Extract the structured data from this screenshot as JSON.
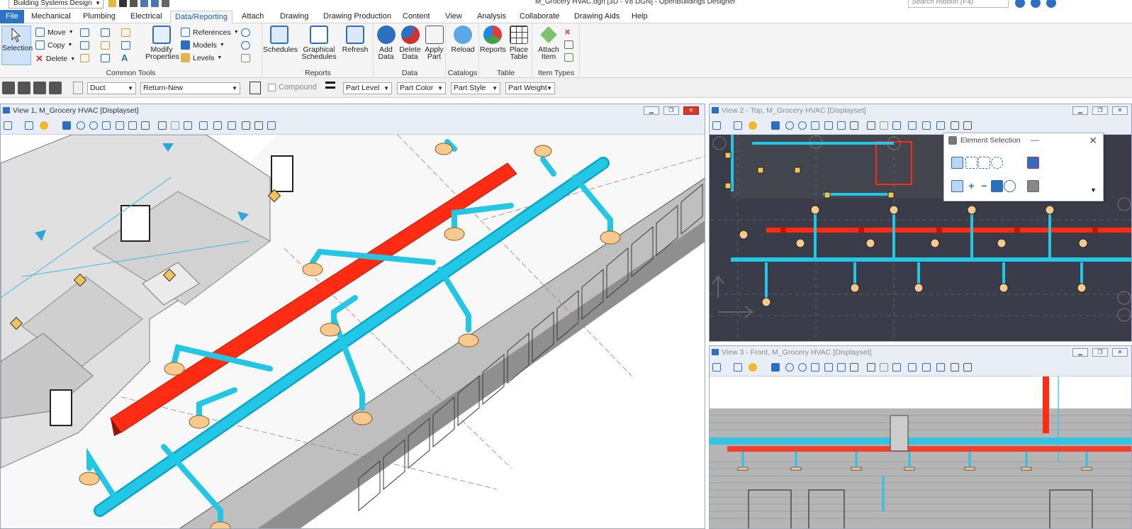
{
  "titlebar": {
    "workspace": "Building Systems Design",
    "title": "M_Grocery HVAC.dgn [3D - V8 DGN] - OpenBuildings Designer",
    "search_placeholder": "Search Ribbon (F4)"
  },
  "menu": {
    "tabs": [
      "File",
      "Mechanical",
      "Plumbing",
      "Electrical",
      "Data/Reporting",
      "Attach",
      "Drawing",
      "Drawing Production",
      "Content",
      "View",
      "Analysis",
      "Collaborate",
      "Drawing Aids",
      "Help"
    ],
    "active": "Data/Reporting"
  },
  "ribbon": {
    "common_tools": {
      "label": "Common Tools",
      "selection": "Selection",
      "move": "Move",
      "copy": "Copy",
      "delete": "Delete",
      "modify_properties": "Modify Properties",
      "references": "References",
      "models": "Models",
      "levels": "Levels"
    },
    "reports": {
      "label": "Reports",
      "schedules": "Schedules",
      "graphical_schedules": "Graphical Schedules",
      "refresh": "Refresh"
    },
    "data": {
      "label": "Data",
      "add_data": "Add Data",
      "delete_data": "Delete Data",
      "apply_part": "Apply Part"
    },
    "catalogs": {
      "label": "Catalogs",
      "reload": "Reload"
    },
    "table": {
      "label": "Table",
      "reports": "Reports",
      "place_table": "Place Table"
    },
    "item_types": {
      "label": "Item Types",
      "attach_item": "Attach Item"
    }
  },
  "toolrow": {
    "type": "Duct",
    "part": "Return-New",
    "compound": "Compound",
    "part_level": "Part Level",
    "part_color": "Part Color",
    "part_style": "Part Style",
    "part_weight": "Part Weight"
  },
  "views": {
    "v1": "View 1, M_Grocery HVAC [Displayset]",
    "v2": "View 2 - Top, M_Grocery HVAC [Displayset]",
    "v3": "View 3 - Front, M_Grocery HVAC [Displayset]"
  },
  "element_selection": {
    "title": "Element Selection"
  },
  "colors": {
    "accent": "#2b73c8",
    "duct_cyan": "#22c7e6",
    "duct_red": "#ff2b12",
    "dark_view": "#3a3c4a"
  }
}
